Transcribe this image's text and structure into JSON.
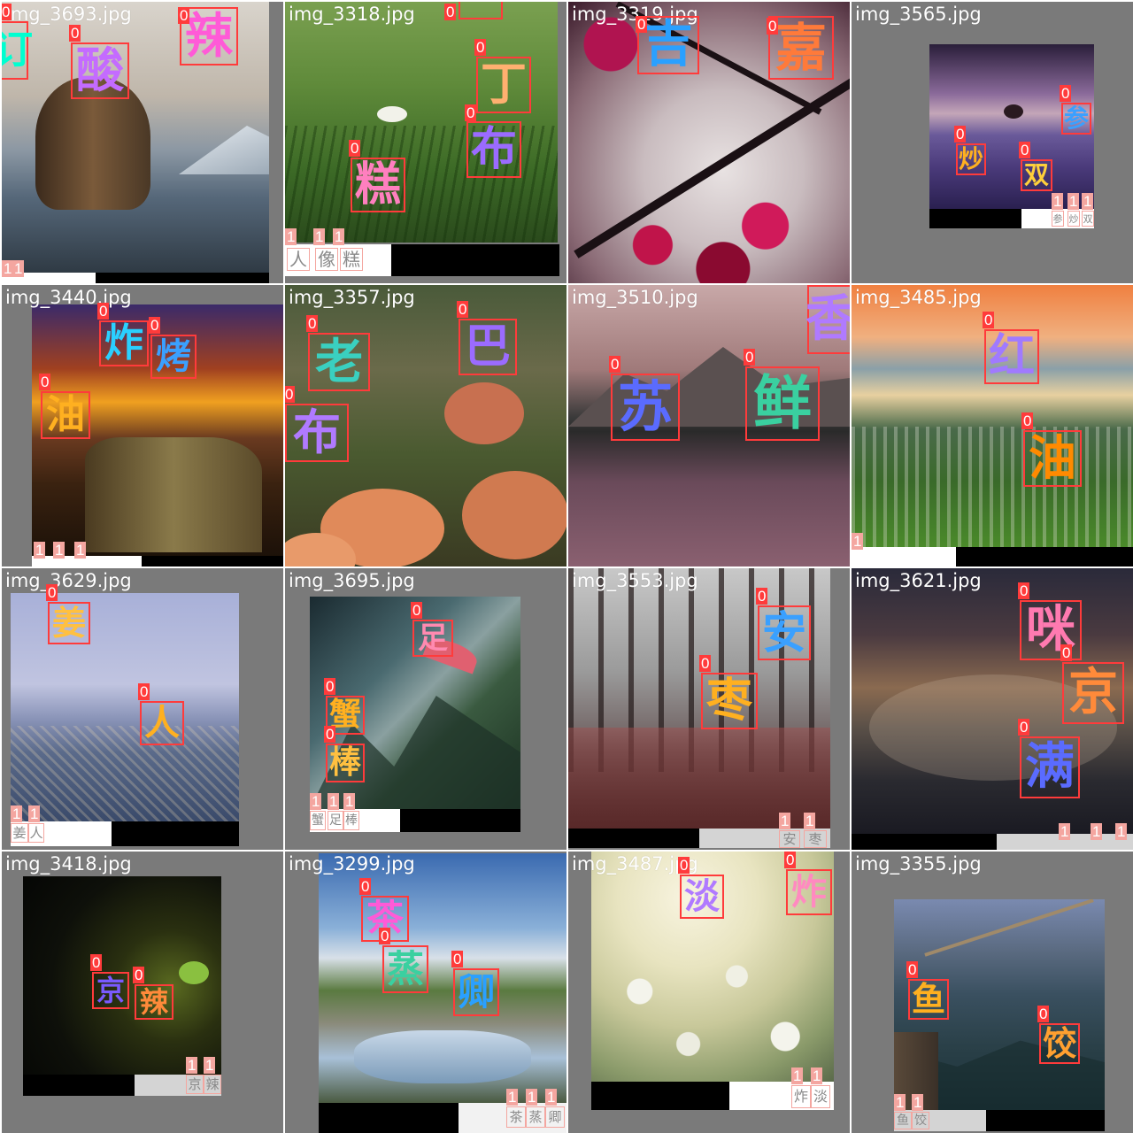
{
  "colors": {
    "box_class0": "#ff3b3b",
    "box_class1": "#f4a6a0",
    "letterbox": "#7a7a7a"
  },
  "tiles": [
    {
      "filename": "img_3693.jpg",
      "photo": "sea-stack-rock-beach-sunset",
      "dets": [
        {
          "cls": "0",
          "char": "订",
          "color": "#00ffd0"
        },
        {
          "cls": "0",
          "char": "酸",
          "color": "#c46bff"
        },
        {
          "cls": "0",
          "char": "辣",
          "color": "#ff5ad7"
        },
        {
          "cls": "1",
          "char": "",
          "color": "#999999"
        }
      ]
    },
    {
      "filename": "img_3318.jpg",
      "photo": "green-grass-flowers",
      "dets": [
        {
          "cls": "0",
          "char": "",
          "color": "#ff66aa"
        },
        {
          "cls": "0",
          "char": "丁",
          "color": "#ffb070"
        },
        {
          "cls": "0",
          "char": "布",
          "color": "#9b6bff"
        },
        {
          "cls": "0",
          "char": "糕",
          "color": "#ff7fbf"
        },
        {
          "cls": "1",
          "char": "人",
          "color": "#999999"
        },
        {
          "cls": "1",
          "char": "像",
          "color": "#999999"
        },
        {
          "cls": "1",
          "char": "糕",
          "color": "#999999"
        }
      ]
    },
    {
      "filename": "img_3319.jpg",
      "photo": "tree-branches-red-leaves",
      "dets": [
        {
          "cls": "0",
          "char": "吉",
          "color": "#2aa0ff"
        },
        {
          "cls": "0",
          "char": "嘉",
          "color": "#ff7a3a"
        }
      ]
    },
    {
      "filename": "img_3565.jpg",
      "photo": "lavender-field-lone-tree",
      "dets": [
        {
          "cls": "0",
          "char": "参",
          "color": "#3aa0ff"
        },
        {
          "cls": "0",
          "char": "炒",
          "color": "#ffb020"
        },
        {
          "cls": "0",
          "char": "双",
          "color": "#ffd03a"
        },
        {
          "cls": "1",
          "char": "参",
          "color": "#999999"
        },
        {
          "cls": "1",
          "char": "炒",
          "color": "#999999"
        },
        {
          "cls": "1",
          "char": "双",
          "color": "#999999"
        }
      ]
    },
    {
      "filename": "img_3440.jpg",
      "photo": "rocky-coast-fiery-sunset",
      "dets": [
        {
          "cls": "0",
          "char": "炸",
          "color": "#2ad0ff"
        },
        {
          "cls": "0",
          "char": "烤",
          "color": "#3aa0ff"
        },
        {
          "cls": "0",
          "char": "油",
          "color": "#ffb020"
        },
        {
          "cls": "1",
          "char": "",
          "color": "#999999"
        },
        {
          "cls": "1",
          "char": "",
          "color": "#999999"
        },
        {
          "cls": "1",
          "char": "",
          "color": "#999999"
        }
      ]
    },
    {
      "filename": "img_3357.jpg",
      "photo": "orange-poppies-field",
      "dets": [
        {
          "cls": "0",
          "char": "老",
          "color": "#3ad0c0"
        },
        {
          "cls": "0",
          "char": "巴",
          "color": "#9b6bff"
        },
        {
          "cls": "0",
          "char": "布",
          "color": "#b07aff"
        }
      ]
    },
    {
      "filename": "img_3510.jpg",
      "photo": "mountain-lake-reflection-dusk",
      "dets": [
        {
          "cls": "0",
          "char": "香",
          "color": "#b07aff"
        },
        {
          "cls": "0",
          "char": "苏",
          "color": "#5a6bff"
        },
        {
          "cls": "0",
          "char": "鲜",
          "color": "#3ad0a0"
        }
      ]
    },
    {
      "filename": "img_3485.jpg",
      "photo": "lakeside-village-sunset",
      "dets": [
        {
          "cls": "0",
          "char": "红",
          "color": "#a07aff"
        },
        {
          "cls": "0",
          "char": "油",
          "color": "#ff8a00"
        },
        {
          "cls": "1",
          "char": "",
          "color": "#999999"
        }
      ]
    },
    {
      "filename": "img_3629.jpg",
      "photo": "coastal-town-dusk",
      "dets": [
        {
          "cls": "0",
          "char": "姜",
          "color": "#ffc040"
        },
        {
          "cls": "0",
          "char": "人",
          "color": "#ffb020"
        },
        {
          "cls": "1",
          "char": "姜",
          "color": "#999999"
        },
        {
          "cls": "1",
          "char": "人",
          "color": "#999999"
        }
      ]
    },
    {
      "filename": "img_3695.jpg",
      "photo": "paraglider-mountain-valley",
      "dets": [
        {
          "cls": "0",
          "char": "足",
          "color": "#ff8ab0"
        },
        {
          "cls": "0",
          "char": "蟹",
          "color": "#ffb020"
        },
        {
          "cls": "0",
          "char": "棒",
          "color": "#ffc040"
        },
        {
          "cls": "1",
          "char": "蟹",
          "color": "#999999"
        },
        {
          "cls": "1",
          "char": "足",
          "color": "#999999"
        },
        {
          "cls": "1",
          "char": "棒",
          "color": "#999999"
        }
      ]
    },
    {
      "filename": "img_3553.jpg",
      "photo": "misty-autumn-forest",
      "dets": [
        {
          "cls": "0",
          "char": "安",
          "color": "#3aa0ff"
        },
        {
          "cls": "0",
          "char": "枣",
          "color": "#ffb020"
        },
        {
          "cls": "1",
          "char": "安",
          "color": "#999999"
        },
        {
          "cls": "1",
          "char": "枣",
          "color": "#999999"
        }
      ]
    },
    {
      "filename": "img_3621.jpg",
      "photo": "night-cityscape-fog",
      "dets": [
        {
          "cls": "0",
          "char": "咪",
          "color": "#ff7ab0"
        },
        {
          "cls": "0",
          "char": "京",
          "color": "#ff8a3a"
        },
        {
          "cls": "0",
          "char": "满",
          "color": "#5a6bff"
        },
        {
          "cls": "1",
          "char": "",
          "color": "#999999"
        },
        {
          "cls": "1",
          "char": "",
          "color": "#999999"
        },
        {
          "cls": "1",
          "char": "",
          "color": "#999999"
        }
      ]
    },
    {
      "filename": "img_3418.jpg",
      "photo": "dark-seedling-sprout",
      "dets": [
        {
          "cls": "0",
          "char": "京",
          "color": "#7a5aff"
        },
        {
          "cls": "0",
          "char": "辣",
          "color": "#ff8a3a"
        },
        {
          "cls": "1",
          "char": "京",
          "color": "#999999"
        },
        {
          "cls": "1",
          "char": "辣",
          "color": "#999999"
        }
      ]
    },
    {
      "filename": "img_3299.jpg",
      "photo": "country-road-puddle-sky",
      "dets": [
        {
          "cls": "0",
          "char": "茶",
          "color": "#ff5ad7"
        },
        {
          "cls": "0",
          "char": "蒸",
          "color": "#3ad0a0"
        },
        {
          "cls": "0",
          "char": "卿",
          "color": "#2aa0ff"
        },
        {
          "cls": "1",
          "char": "茶",
          "color": "#999999"
        },
        {
          "cls": "1",
          "char": "蒸",
          "color": "#999999"
        },
        {
          "cls": "1",
          "char": "卿",
          "color": "#999999"
        }
      ]
    },
    {
      "filename": "img_3487.jpg",
      "photo": "white-flowers-bright-light",
      "dets": [
        {
          "cls": "0",
          "char": "淡",
          "color": "#b07aff"
        },
        {
          "cls": "0",
          "char": "炸",
          "color": "#ff8ac0"
        },
        {
          "cls": "1",
          "char": "炸",
          "color": "#999999"
        },
        {
          "cls": "1",
          "char": "淡",
          "color": "#999999"
        }
      ]
    },
    {
      "filename": "img_3355.jpg",
      "photo": "great-wall-mountains",
      "dets": [
        {
          "cls": "0",
          "char": "鱼",
          "color": "#ffb020"
        },
        {
          "cls": "0",
          "char": "饺",
          "color": "#ffa030"
        },
        {
          "cls": "1",
          "char": "鱼",
          "color": "#999999"
        },
        {
          "cls": "1",
          "char": "饺",
          "color": "#999999"
        }
      ]
    }
  ]
}
